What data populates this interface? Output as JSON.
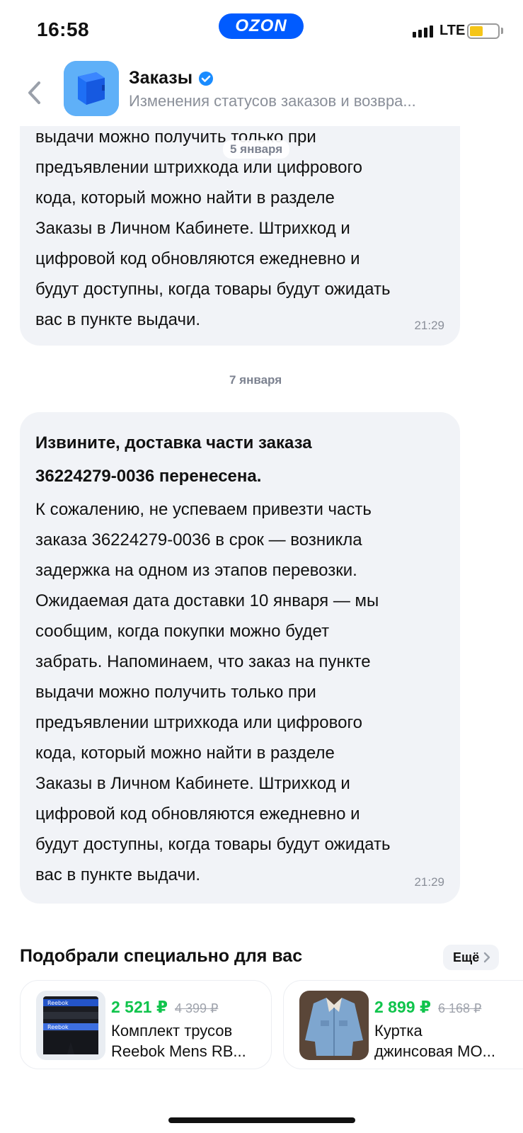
{
  "status_bar": {
    "time": "16:58",
    "app_badge": "OZON",
    "network": "LTE"
  },
  "header": {
    "title": "Заказы",
    "subtitle": "Изменения статусов заказов и возвра...",
    "back_icon": "chevron-left-icon",
    "verified_icon": "verified-check-icon"
  },
  "messages": [
    {
      "date_separator": "5 января",
      "lines": [
        "выдачи можно получить только при",
        "предъявлении штрихкода или цифрового",
        "кода, который можно найти в разделе",
        "Заказы в Личном Кабинете. Штрихкод и",
        "цифровой код обновляются ежедневно и",
        "будут доступны, когда товары будут ожидать",
        "вас в пункте выдачи."
      ],
      "time": "21:29"
    },
    {
      "date_separator": "7 января",
      "title_lines": [
        "Извините, доставка части заказа",
        "36224279-0036 перенесена."
      ],
      "lines": [
        "К сожалению, не успеваем привезти часть",
        "заказа 36224279-0036 в срок — возникла",
        "задержка на одном из этапов перевозки.",
        "Ожидаемая дата доставки 10 января — мы",
        "сообщим, когда покупки можно будет",
        "забрать. Напоминаем, что заказ на пункте",
        "выдачи можно получить только при",
        "предъявлении штрихкода или цифрового",
        "кода, который можно найти в разделе",
        "Заказы в Личном Кабинете. Штрихкод и",
        "цифровой код обновляются ежедневно и",
        "будут доступны, когда товары будут ожидать",
        "вас в пункте выдачи."
      ],
      "time": "21:29"
    }
  ],
  "recommendations": {
    "title": "Подобрали специально для вас",
    "more_label": "Ещё",
    "products": [
      {
        "price": "2 521 ₽",
        "old_price": "4 399 ₽",
        "name_lines": [
          "Комплект трусов",
          "Reebok Mens RB..."
        ],
        "image_icon": "boxer-briefs-image"
      },
      {
        "price": "2 899 ₽",
        "old_price": "6 168 ₽",
        "name_lines": [
          "Куртка",
          "джинсовая МО..."
        ],
        "image_icon": "denim-jacket-image"
      }
    ]
  },
  "colors": {
    "ozon_blue": "#005bff",
    "price_green": "#10c44c",
    "bubble_bg": "#f1f3f7",
    "muted_text": "#8a8f99"
  }
}
